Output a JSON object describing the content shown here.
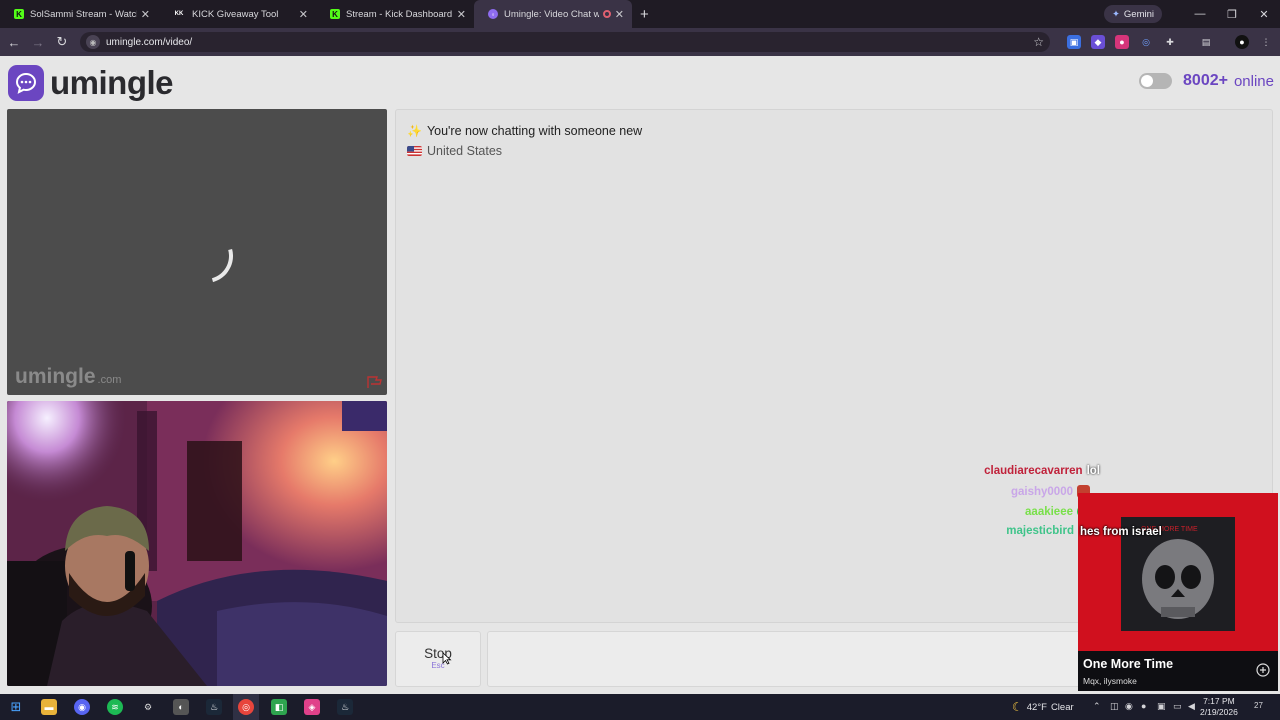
{
  "browser": {
    "tabs": [
      {
        "title": "SolSammi Stream - Watch Live",
        "favicon_color": "#53fc18",
        "favicon": "K",
        "active": false
      },
      {
        "title": "KICK Giveaway Tool",
        "favicon_color": "#ffffff",
        "favicon": "KK",
        "active": false
      },
      {
        "title": "Stream - Kick Dashboard",
        "favicon_color": "#53fc18",
        "favicon": "K",
        "active": false
      },
      {
        "title": "Umingle: Video Chat with S",
        "favicon_color": "#8e6cf0",
        "favicon": "U",
        "active": true
      }
    ],
    "new_tab_icon": "+",
    "gemini_label": "Gemini",
    "url": "umingle.com/video/"
  },
  "page": {
    "logo_text": "umingle",
    "online_count": "8002+",
    "online_label": "online",
    "brand_color": "#6b46c1",
    "video_watermark": "umingle",
    "video_watermark_suffix": ".com",
    "chat_status": "You're now chatting with someone new",
    "chat_country": "United States",
    "stop_label": "Stop",
    "stop_hint": "Esc"
  },
  "overlay": {
    "chat_lines": [
      {
        "user": "claudiarecavarren",
        "message": "lol",
        "color": "#c0213a"
      },
      {
        "user": "gaishy0000",
        "message": "",
        "color": "#c9a6e8",
        "emote_color": "#c2402f"
      },
      {
        "user": "aaakieee",
        "message": "",
        "color": "#79e04a",
        "emote_color": "#33c24a"
      },
      {
        "user": "majesticbird",
        "message": "hes from israel",
        "color": "#3fc48a"
      }
    ],
    "now_playing": {
      "title": "One More Time",
      "artist": "Mqx, ilysmoke",
      "art_color": "#d0101e"
    }
  },
  "taskbar": {
    "weather_temp": "42°F",
    "weather_cond": "Clear",
    "time": "7:17 PM",
    "date": "2/19/2026",
    "notification_count": "27"
  }
}
